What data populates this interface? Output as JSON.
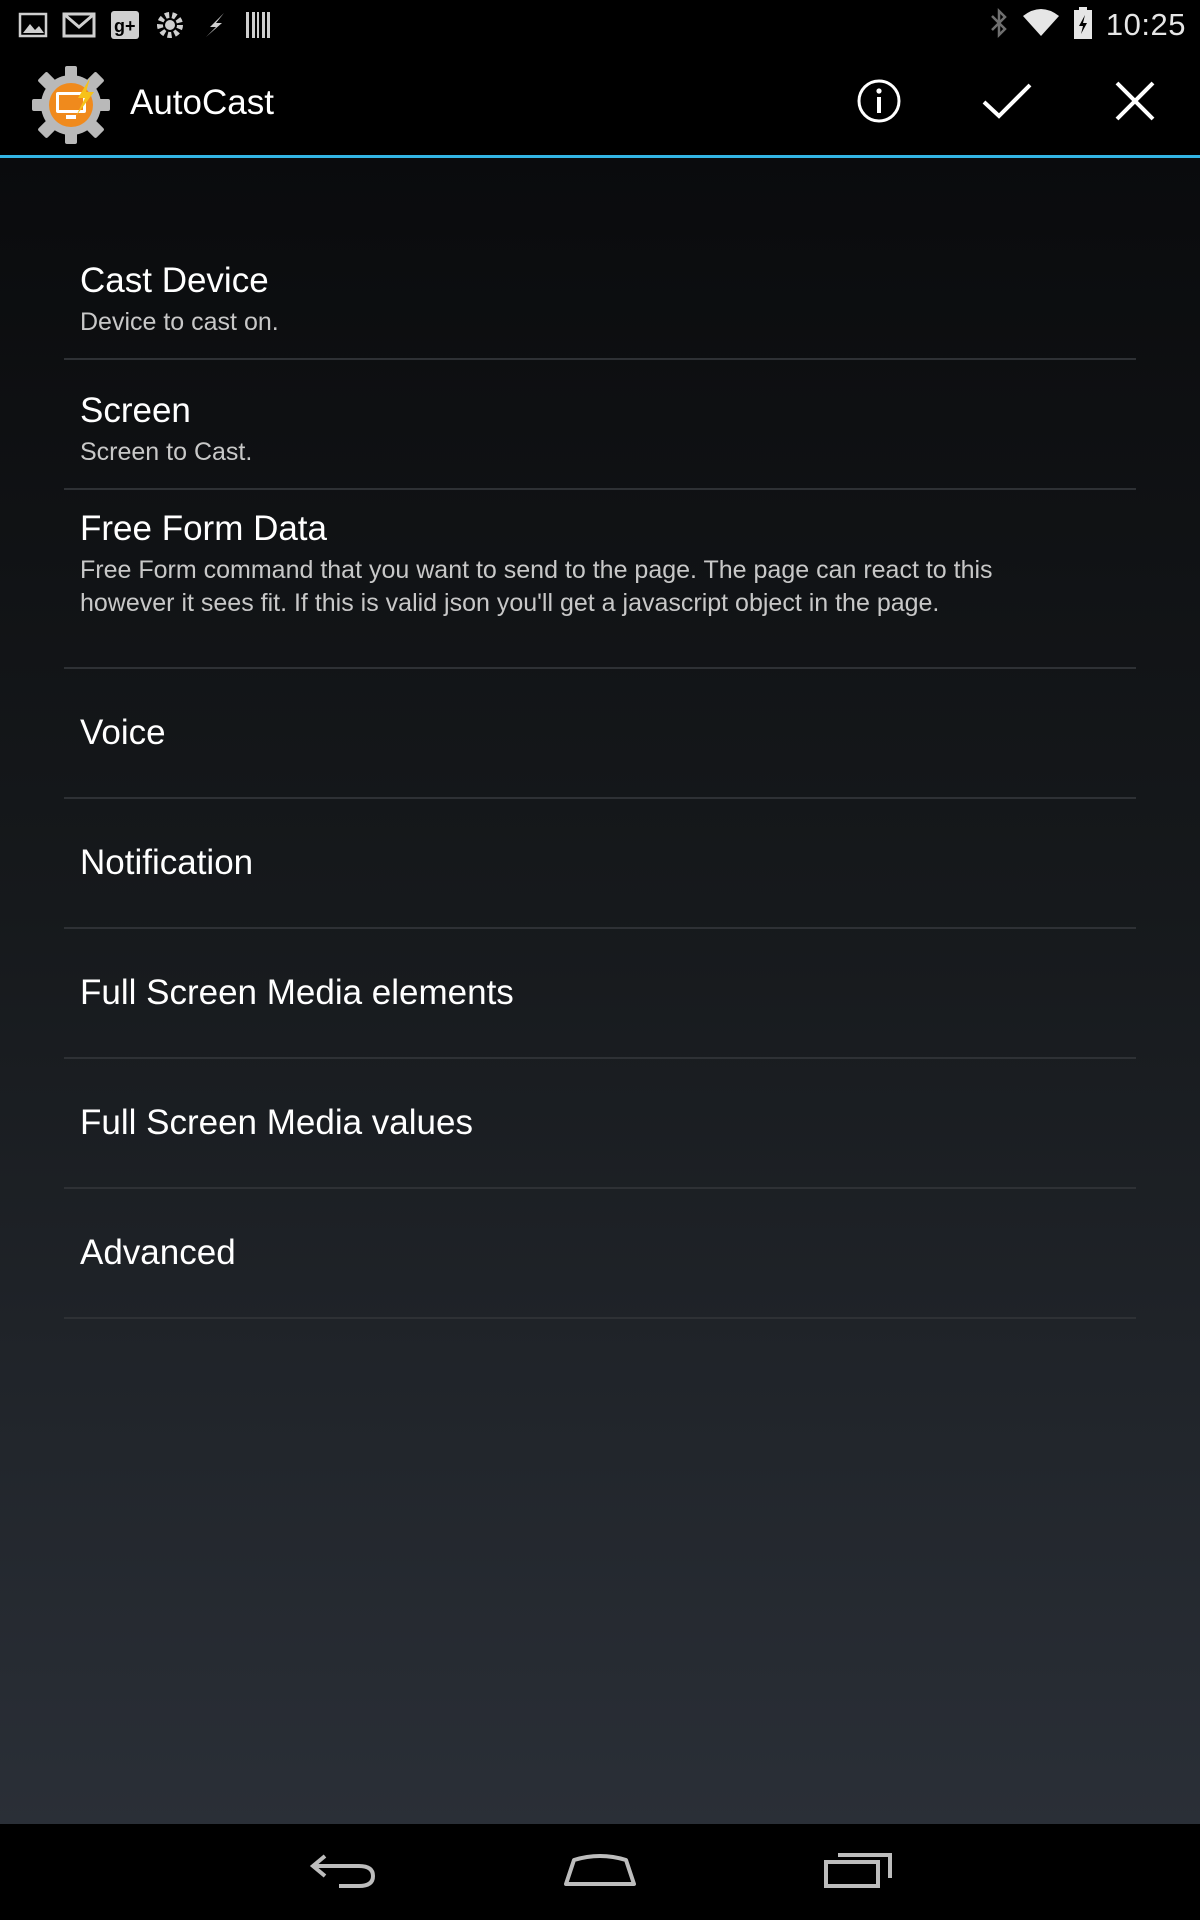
{
  "status_bar": {
    "time": "10:25",
    "left_icons": [
      "gallery-icon",
      "gmail-icon",
      "google-plus-icon",
      "tasker-icon",
      "flash-icon",
      "barcode-icon"
    ],
    "right_icons": [
      "bluetooth-icon",
      "wifi-icon",
      "battery-icon"
    ]
  },
  "action_bar": {
    "title": "AutoCast",
    "actions": [
      "info-icon",
      "check-icon",
      "close-icon"
    ],
    "accent_color": "#33b5e5"
  },
  "preferences": [
    {
      "title": "Cast Device",
      "summary": "Device to cast on."
    },
    {
      "title": "Screen",
      "summary": "Screen to Cast."
    },
    {
      "title": "Free Form Data",
      "summary": "Free Form command that you want to send to the page. The page can react to this however it sees fit. If this is valid json you'll get a javascript object in the page."
    },
    {
      "title": "Voice"
    },
    {
      "title": "Notification"
    },
    {
      "title": "Full Screen Media elements"
    },
    {
      "title": "Full Screen Media values"
    },
    {
      "title": "Advanced"
    }
  ],
  "nav_bar": {
    "buttons": [
      "back-icon",
      "home-icon",
      "recents-icon"
    ]
  }
}
